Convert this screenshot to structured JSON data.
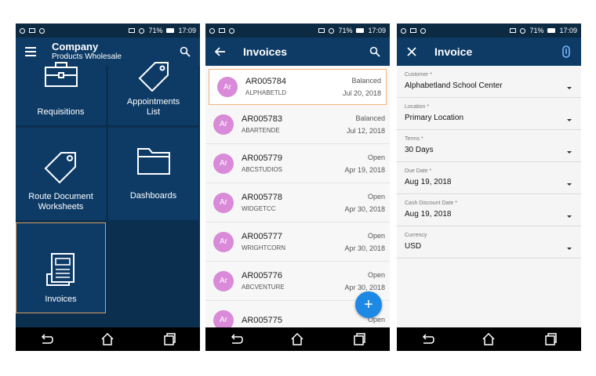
{
  "status_bar": {
    "battery": "71%",
    "time": "17:09"
  },
  "home": {
    "company_line1": "Company",
    "company_line2": "Products Wholesale",
    "tiles": [
      {
        "label": "Requisitions"
      },
      {
        "label": "Appointments List"
      },
      {
        "label": "Route Document Worksheets"
      },
      {
        "label": "Dashboards"
      },
      {
        "label": "Invoices"
      }
    ]
  },
  "invoices_list": {
    "title": "Invoices",
    "rows": [
      {
        "avatar": "Ar",
        "id": "AR005784",
        "status": "Balanced",
        "customer": "ALPHABETLD",
        "date": "Jul 20, 2018"
      },
      {
        "avatar": "Ar",
        "id": "AR005783",
        "status": "Balanced",
        "customer": "ABARTENDE",
        "date": "Jul 12, 2018"
      },
      {
        "avatar": "Ar",
        "id": "AR005779",
        "status": "Open",
        "customer": "ABCSTUDIOS",
        "date": "Apr 19, 2018"
      },
      {
        "avatar": "Ar",
        "id": "AR005778",
        "status": "Open",
        "customer": "WIDGETCC",
        "date": "Apr 30, 2018"
      },
      {
        "avatar": "Ar",
        "id": "AR005777",
        "status": "Open",
        "customer": "WRIGHTCORN",
        "date": "Apr 30, 2018"
      },
      {
        "avatar": "Ar",
        "id": "AR005776",
        "status": "Open",
        "customer": "ABCVENTURE",
        "date": "Apr 30, 2018"
      },
      {
        "avatar": "Ar",
        "id": "AR005775",
        "status": "Open",
        "customer": "",
        "date": ""
      }
    ],
    "fab_label": "+"
  },
  "invoice_form": {
    "title": "Invoice",
    "fields": [
      {
        "label": "Customer *",
        "value": "Alphabetland School Center"
      },
      {
        "label": "Location *",
        "value": "Primary Location"
      },
      {
        "label": "Terms *",
        "value": "30 Days"
      },
      {
        "label": "Due Date *",
        "value": "Aug 19, 2018"
      },
      {
        "label": "Cash Discount Date *",
        "value": "Aug 19, 2018"
      },
      {
        "label": "Currency",
        "value": "USD"
      }
    ]
  },
  "colors": {
    "app_bar": "#0d3b66",
    "status_bar": "#0d2a43",
    "tile": "#0d3b66",
    "avatar": "#d98ad8",
    "fab": "#1e88e5",
    "selected_border": "#f2b37a"
  }
}
